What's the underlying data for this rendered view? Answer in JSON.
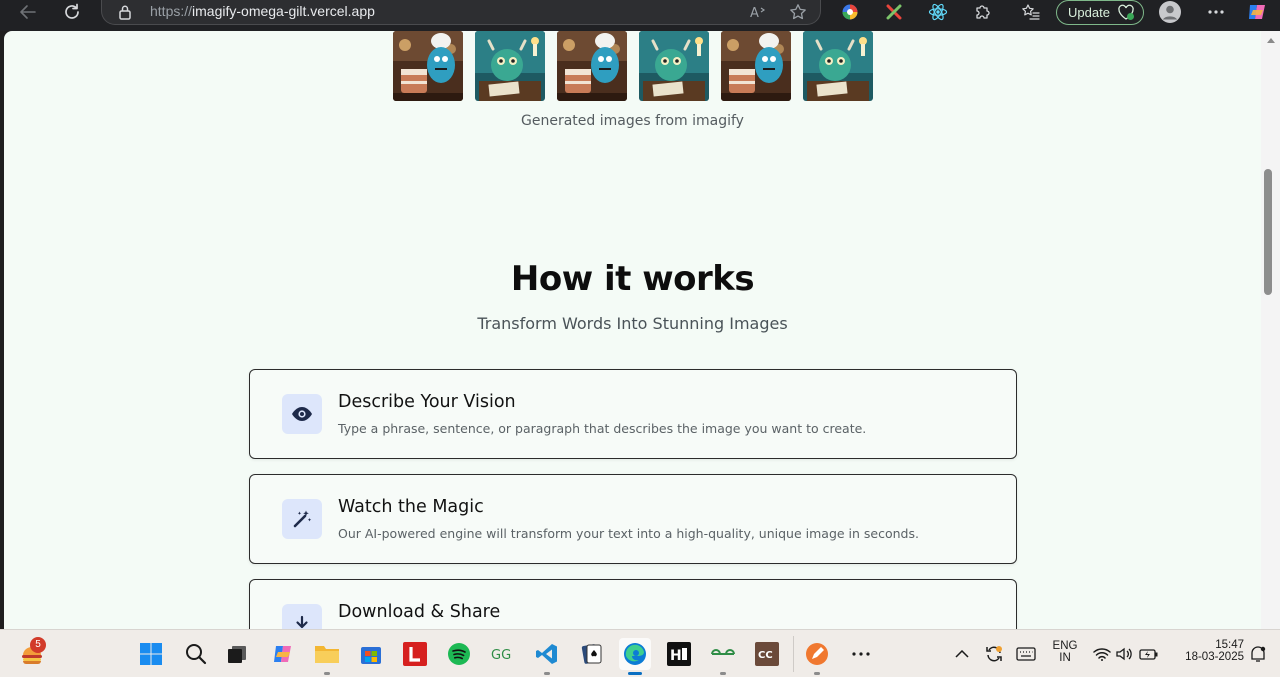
{
  "browser": {
    "url_prefix": "https://",
    "url_host": "imagify-omega-gilt.vercel.app",
    "update_label": "Update"
  },
  "page": {
    "gallery_caption": "Generated images from imagify",
    "how_title": "How it works",
    "how_subtitle": "Transform Words Into Stunning Images",
    "steps": [
      {
        "title": "Describe Your Vision",
        "description": "Type a phrase, sentence, or paragraph that describes the image you want to create.",
        "icon": "eye-icon"
      },
      {
        "title": "Watch the Magic",
        "description": "Our AI-powered engine will transform your text into a high-quality, unique image in seconds.",
        "icon": "magic-wand-icon"
      },
      {
        "title": "Download & Share",
        "description": "",
        "icon": "download-icon"
      }
    ],
    "gallery": [
      "chef-monster-cake",
      "monster-desk-candle",
      "chef-monster-cake",
      "monster-desk-candle",
      "chef-monster-cake",
      "monster-desk-candle"
    ]
  },
  "taskbar": {
    "notification_count": "5",
    "language": "ENG",
    "region": "IN",
    "time": "15:47",
    "date": "18-03-2025"
  },
  "colors": {
    "page_bg": "#f4fbf6",
    "icon_bg": "#dde6fb",
    "icon_fg": "#1e2a4a",
    "chrome_bg": "#202124",
    "update_border": "#7fb88a"
  }
}
